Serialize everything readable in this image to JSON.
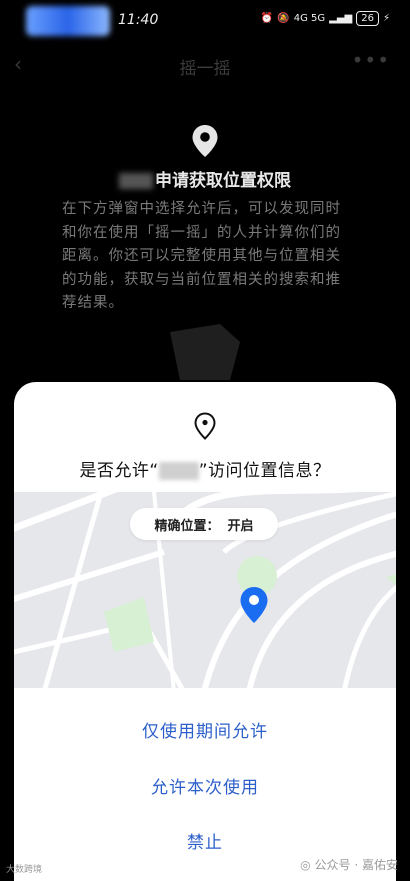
{
  "status_bar": {
    "time": "11:40",
    "indicators": "4G  5G",
    "battery": "26"
  },
  "navbar": {
    "back_icon": "chevron-left-icon",
    "title": "摇一摇",
    "more_icon": "more-dots-icon"
  },
  "permission_info": {
    "title": "申请获取位置权限",
    "description": "在下方弹窗中选择允许后，可以发现同时和你在使用「摇一摇」的人并计算你们的距离。你还可以完整使用其他与位置相关的功能，获取与当前位置相关的搜索和推荐结果。"
  },
  "dialog": {
    "question_prefix": "是否允许“",
    "question_suffix": "”访问位置信息？",
    "chip_label": "精确位置：",
    "chip_value": "开启",
    "actions": [
      {
        "label": "仅使用期间允许"
      },
      {
        "label": "允许本次使用"
      },
      {
        "label": "禁止"
      }
    ],
    "accent_color": "#2c5fc9"
  },
  "watermark": {
    "left": "大数跨境",
    "right": "公众号 · 嘉佑安"
  }
}
